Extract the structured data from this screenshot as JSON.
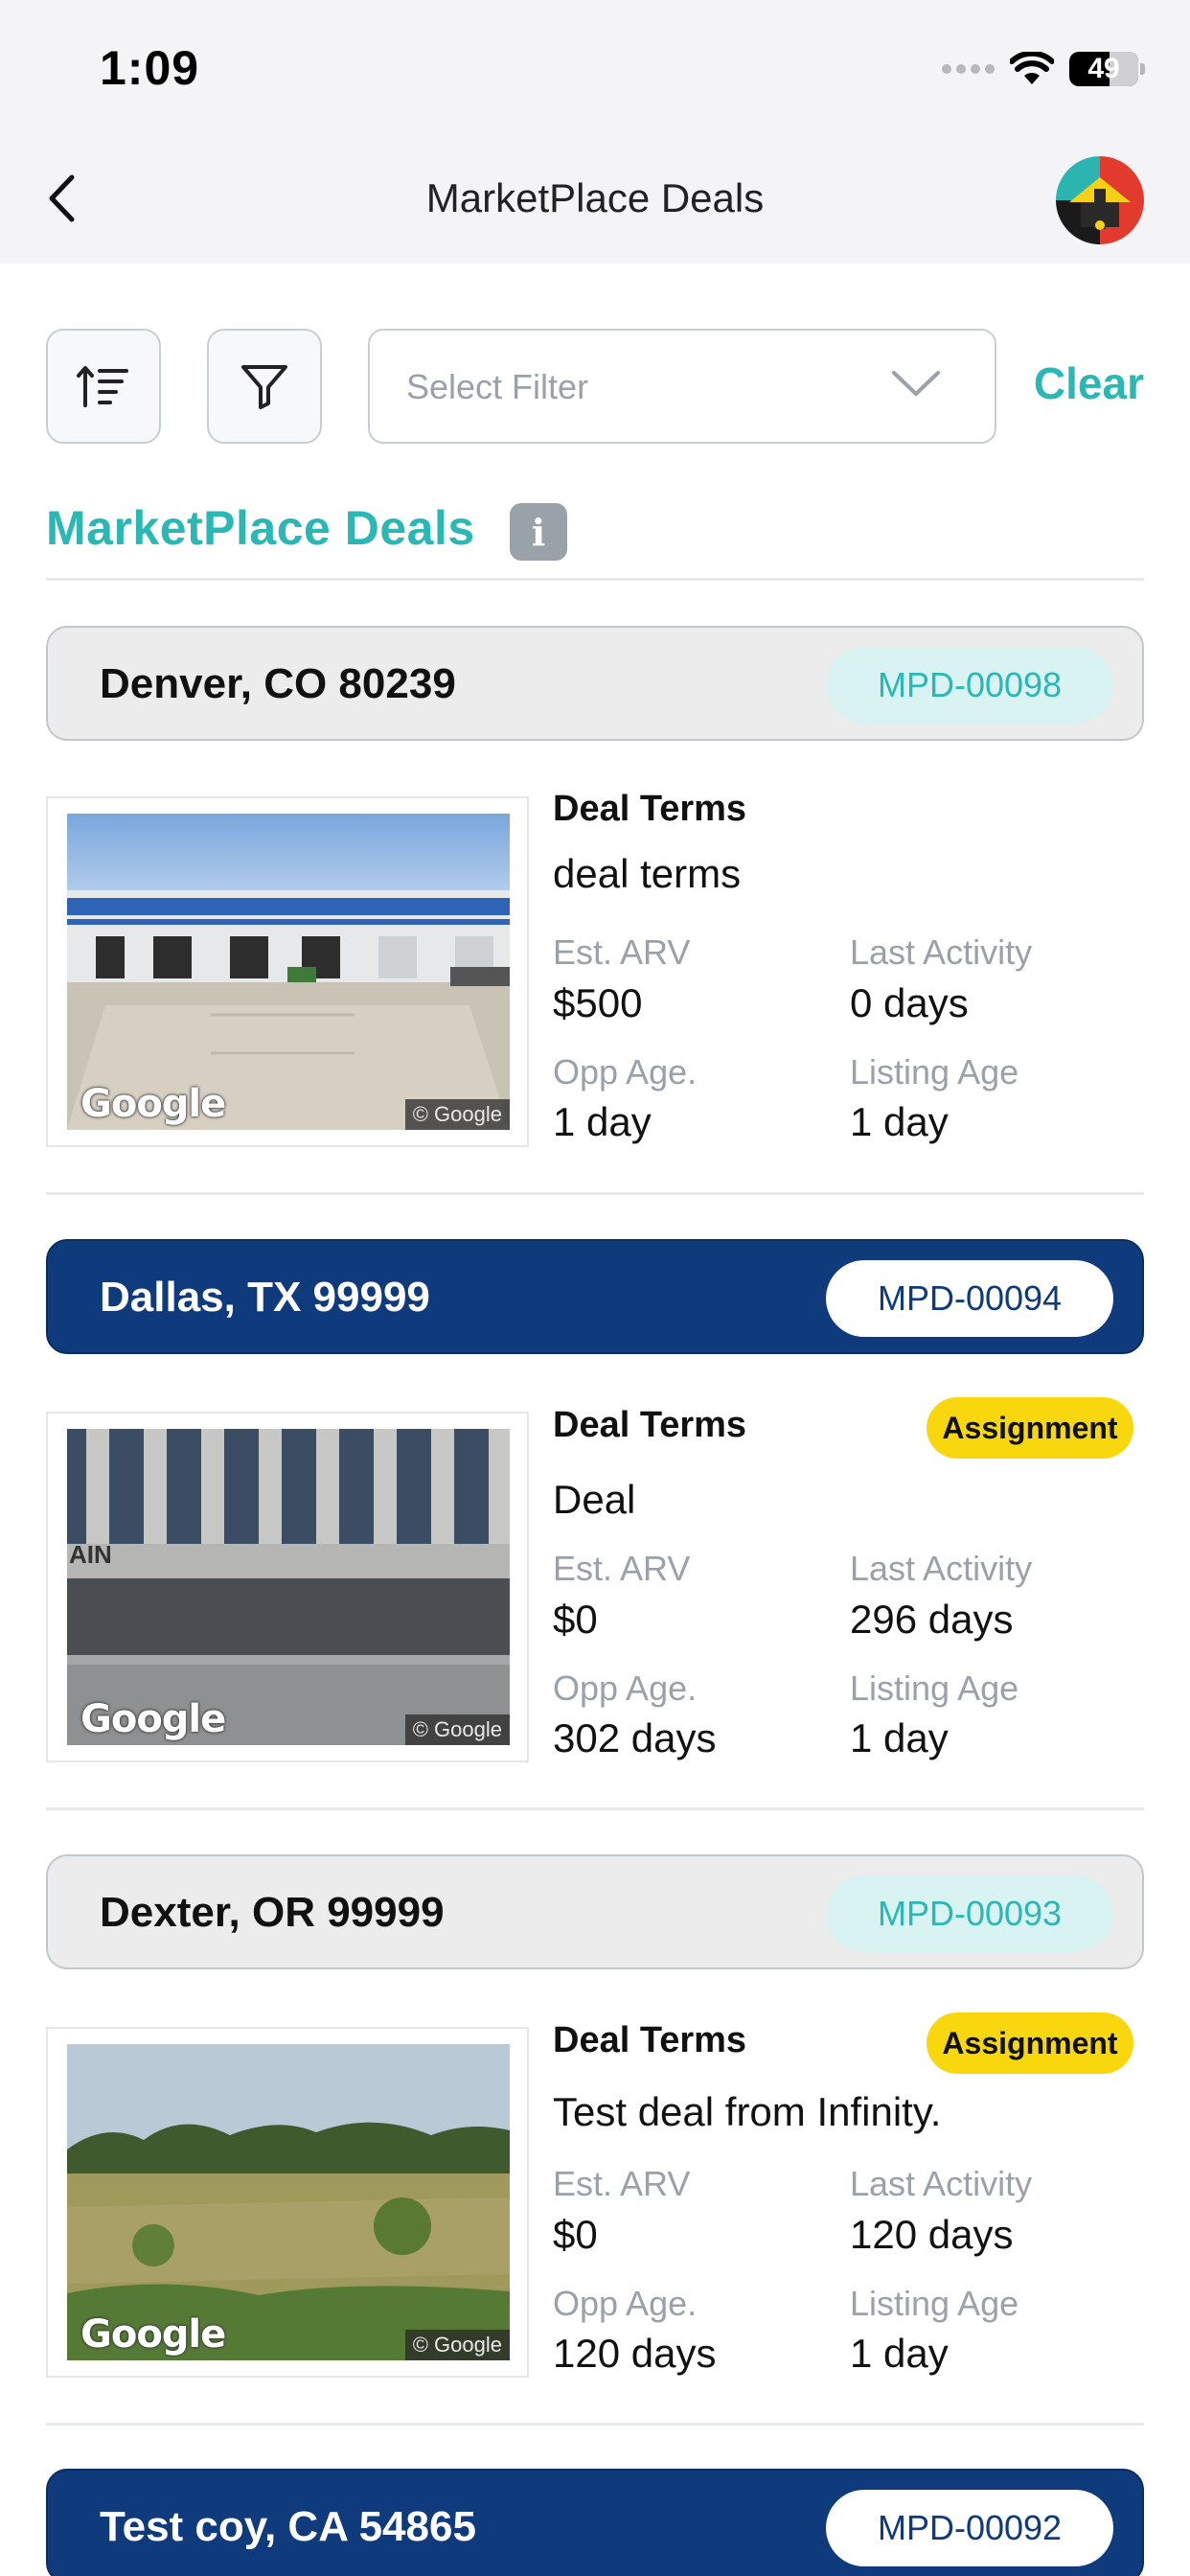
{
  "status_bar": {
    "time": "1:09",
    "battery": "49"
  },
  "nav": {
    "title": "MarketPlace Deals"
  },
  "toolbar": {
    "select_placeholder": "Select Filter",
    "clear_label": "Clear"
  },
  "section": {
    "title": "MarketPlace Deals"
  },
  "labels": {
    "deal_terms": "Deal Terms",
    "est_arv": "Est. ARV",
    "last_activity": "Last Activity",
    "opp_age": "Opp Age.",
    "listing_age": "Listing Age",
    "google": "Google",
    "google_copy": "© Google"
  },
  "deals": [
    {
      "location": "Denver, CO  80239",
      "code": "MPD-00098",
      "style": "light",
      "tag": "",
      "terms": "deal terms",
      "est_arv": "$500",
      "last_activity": "0 days",
      "opp_age": "1 day",
      "listing_age": "1 day"
    },
    {
      "location": "Dallas, TX  99999",
      "code": "MPD-00094",
      "style": "dark",
      "tag": "Assignment",
      "terms": "Deal",
      "est_arv": "$0",
      "last_activity": "296 days",
      "opp_age": "302 days",
      "listing_age": "1 day"
    },
    {
      "location": "Dexter, OR  99999",
      "code": "MPD-00093",
      "style": "light",
      "tag": "Assignment",
      "terms": "Test deal from Infinity.",
      "est_arv": "$0",
      "last_activity": "120 days",
      "opp_age": "120 days",
      "listing_age": "1 day"
    },
    {
      "location": "Test coy, CA  54865",
      "code": "MPD-00092",
      "style": "dark"
    }
  ],
  "colors": {
    "accent": "#2bb7b3",
    "navy": "#0f3b7c",
    "assignment": "#f8d70f"
  }
}
